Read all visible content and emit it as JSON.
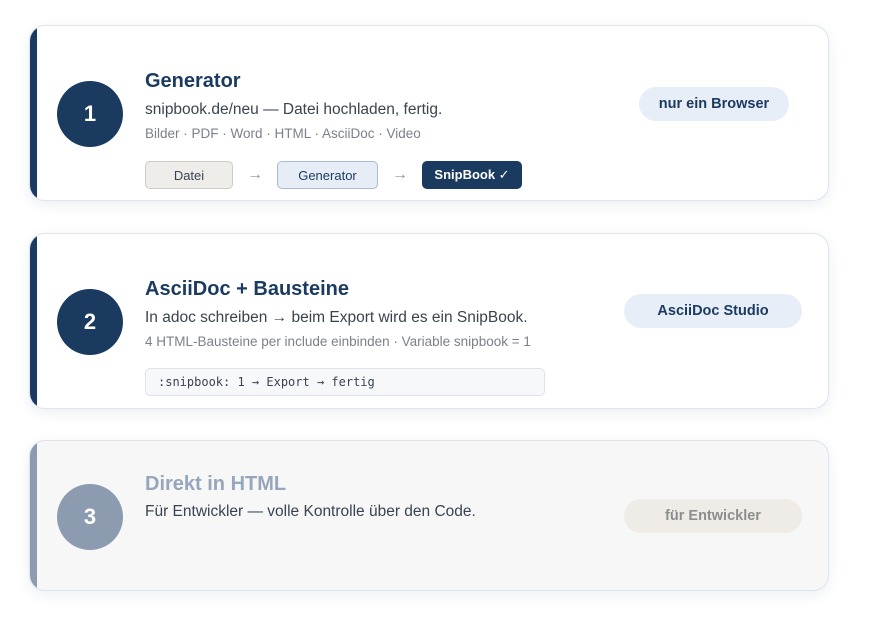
{
  "cards": [
    {
      "number": "1",
      "title": "Generator",
      "description": "snipbook.de/neu — Datei hochladen, fertig.",
      "subtext": "Bilder · PDF · Word · HTML · AsciiDoc · Video",
      "badge": "nur ein Browser",
      "flow": {
        "step1": "Datei",
        "step2": "Generator",
        "step3": "SnipBook ✓",
        "arrow": "→"
      }
    },
    {
      "number": "2",
      "title": "AsciiDoc + Bausteine",
      "description": "In adoc schreiben → beim Export wird es ein SnipBook.",
      "subtext": "4 HTML-Bausteine per include einbinden · Variable snipbook = 1",
      "badge": "AsciiDoc Studio",
      "code": ":snipbook: 1 → Export → fertig"
    },
    {
      "number": "3",
      "title": "Direkt in HTML",
      "description": "Für Entwickler — volle Kontrolle über den Code.",
      "badge": "für Entwickler"
    }
  ],
  "colors": {
    "accent": "#1b3a5f",
    "muted_accent": "#8c9bb0",
    "badge_bg": "#e8eef7"
  }
}
